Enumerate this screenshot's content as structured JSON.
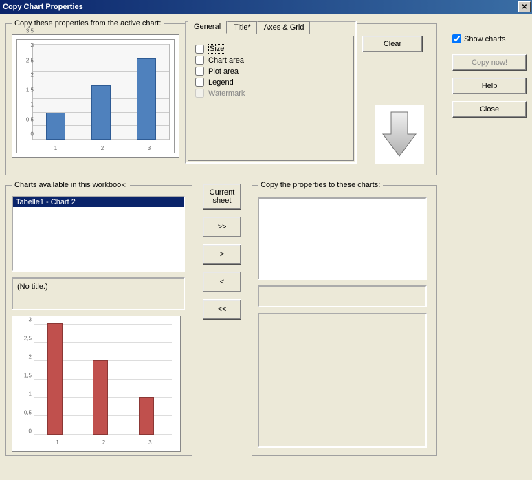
{
  "window": {
    "title": "Copy Chart Properties"
  },
  "groups": {
    "source": "Copy these properties from the active chart:",
    "available": "Charts available in this workbook:",
    "target": "Copy the properties to these charts:"
  },
  "tabs": {
    "general": "General",
    "title": "Title*",
    "axesgrid": "Axes & Grid"
  },
  "options": {
    "size": "Size",
    "chartarea": "Chart area",
    "plotarea": "Plot area",
    "legend": "Legend",
    "watermark": "Watermark"
  },
  "buttons": {
    "clear": "Clear",
    "current_sheet_l1": "Current",
    "current_sheet_l2": "sheet",
    "add_all": ">>",
    "add_one": ">",
    "remove_one": "<",
    "remove_all": "<<",
    "show_charts": "Show charts",
    "copy_now": "Copy now!",
    "help": "Help",
    "close": "Close"
  },
  "available_list": {
    "item0": "Tabelle1 - Chart 2",
    "no_title": "(No title.)"
  },
  "chart_data": [
    {
      "type": "bar",
      "categories": [
        "1",
        "2",
        "3"
      ],
      "values": [
        1,
        2,
        3
      ],
      "ylim": [
        0,
        3.5
      ],
      "yticks": [
        0,
        0.5,
        1,
        1.5,
        2,
        2.5,
        3,
        3.5
      ],
      "title": "",
      "xlabel": "",
      "ylabel": ""
    },
    {
      "type": "bar",
      "style": "3d",
      "categories": [
        "1",
        "2",
        "3"
      ],
      "values": [
        3,
        2,
        1
      ],
      "ylim": [
        0,
        3
      ],
      "yticks": [
        0,
        0.5,
        1,
        1.5,
        2,
        2.5,
        3
      ],
      "title": "",
      "xlabel": "",
      "ylabel": ""
    }
  ]
}
